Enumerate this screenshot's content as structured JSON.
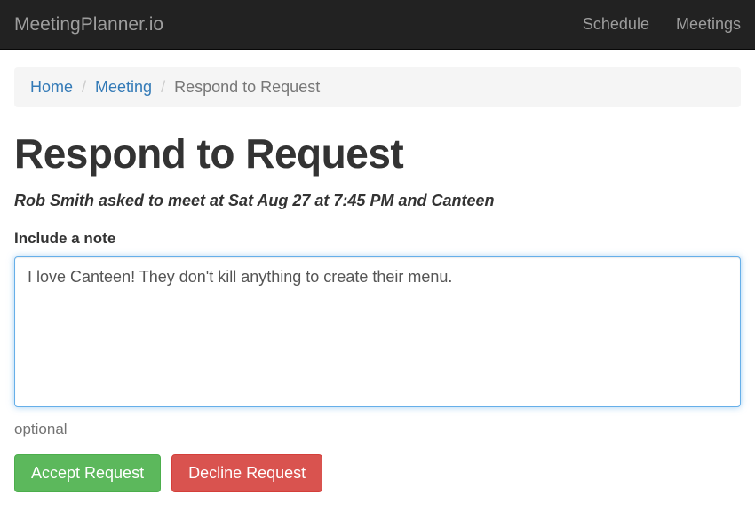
{
  "navbar": {
    "brand": "MeetingPlanner.io",
    "links": {
      "schedule": "Schedule",
      "meetings": "Meetings"
    }
  },
  "breadcrumb": {
    "home": "Home",
    "meeting": "Meeting",
    "current": "Respond to Request",
    "separator": "/"
  },
  "page": {
    "title": "Respond to Request",
    "subtitle": "Rob Smith asked to meet at Sat Aug 27 at 7:45 PM and Canteen"
  },
  "form": {
    "note_label": "Include a note",
    "note_value": "I love Canteen! They don't kill anything to create their menu.",
    "note_help": "optional",
    "accept_label": "Accept Request",
    "decline_label": "Decline Request"
  }
}
